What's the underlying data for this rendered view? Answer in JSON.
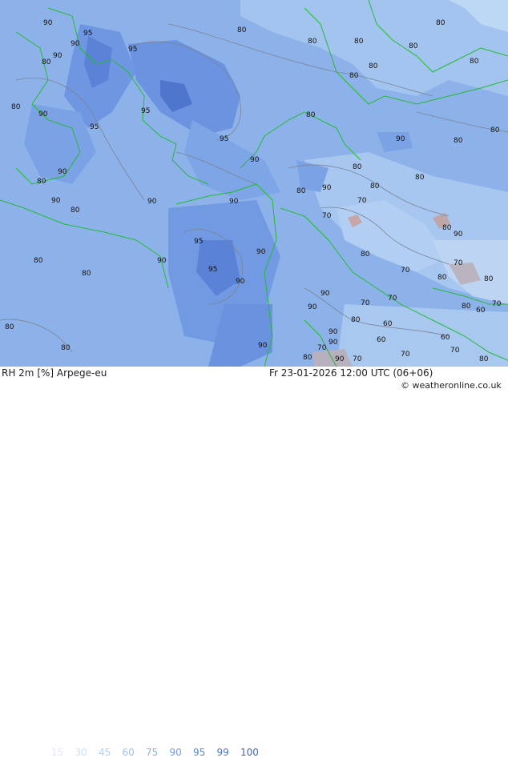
{
  "map": {
    "contour_labels": [
      "80",
      "90",
      "95",
      "70",
      "60"
    ],
    "colors": {
      "sea_high": "#5f86dd",
      "land_base": "#8db2ea",
      "land_low": "#b7d3f2",
      "coast": "#22bb33"
    }
  },
  "footer": {
    "variable": "RH 2m [%] Arpege-eu",
    "datetime": "Fr 23-01-2026 12:00 UTC (06+06)",
    "credit": "© weatheronline.co.uk",
    "legend": [
      {
        "value": "15",
        "color": "#d8eaff"
      },
      {
        "value": "30",
        "color": "#c8e0fb"
      },
      {
        "value": "45",
        "color": "#b3d2f5"
      },
      {
        "value": "60",
        "color": "#9cc2f0"
      },
      {
        "value": "75",
        "color": "#86b2ea"
      },
      {
        "value": "90",
        "color": "#6f9be2"
      },
      {
        "value": "95",
        "color": "#5b87d8"
      },
      {
        "value": "99",
        "color": "#4a74cc"
      },
      {
        "value": "100",
        "color": "#3f65c0"
      }
    ]
  }
}
